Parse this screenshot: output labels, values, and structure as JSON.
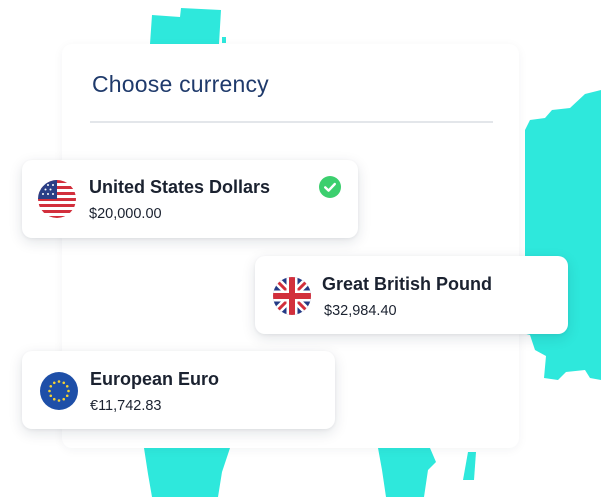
{
  "panel": {
    "title": "Choose currency"
  },
  "currencies": [
    {
      "name": "United States Dollars",
      "amount": "$20,000.00",
      "flag_icon": "us-flag-icon",
      "selected": true
    },
    {
      "name": "Great British Pound",
      "amount": "$32,984.40",
      "flag_icon": "uk-flag-icon",
      "selected": false
    },
    {
      "name": "European Euro",
      "amount": "€11,742.83",
      "flag_icon": "eu-flag-icon",
      "selected": false
    }
  ],
  "colors": {
    "accent_teal": "#2ee8dc",
    "title_navy": "#1f3a6b",
    "check_green": "#3ccf6e",
    "text_dark": "#1b2230"
  }
}
